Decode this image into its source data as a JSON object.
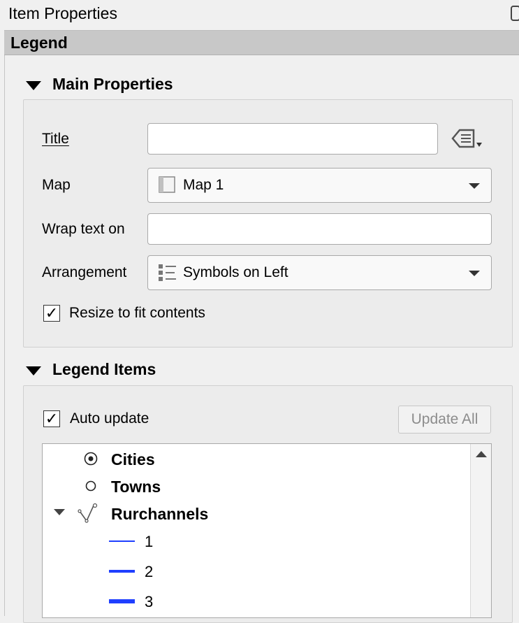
{
  "panel": {
    "title": "Item Properties"
  },
  "section": {
    "title": "Legend"
  },
  "main_properties": {
    "header": "Main Properties",
    "title_label": "Title",
    "title_value": "",
    "map_label": "Map",
    "map_value": "Map 1",
    "wrap_label": "Wrap text on",
    "wrap_value": "",
    "arrangement_label": "Arrangement",
    "arrangement_value": "Symbols on Left",
    "resize_label": "Resize to fit contents",
    "resize_checked": true
  },
  "legend_items": {
    "header": "Legend Items",
    "auto_update_label": "Auto update",
    "auto_update_checked": true,
    "update_all_label": "Update All",
    "tree": [
      {
        "label": "Cities",
        "symbol": "dot-circle"
      },
      {
        "label": "Towns",
        "symbol": "circle"
      },
      {
        "label": "Rurchannels",
        "symbol": "line-layer",
        "expanded": true,
        "children": [
          {
            "label": "1",
            "symbol_color": "#1f3fff"
          },
          {
            "label": "2",
            "symbol_color": "#1f3fff"
          },
          {
            "label": "3",
            "symbol_color": "#1f3fff"
          }
        ]
      }
    ]
  },
  "glyphs": {
    "check": "✓"
  },
  "colors": {
    "section_bar": "#c8c8c8",
    "line_symbol": "#1f3fff"
  },
  "icons": [
    "float-icon",
    "expression-icon",
    "map-icon",
    "arrangement-icon",
    "dropdown-arrow-icon",
    "collapse-triangle-icon",
    "scroll-up-icon"
  ]
}
